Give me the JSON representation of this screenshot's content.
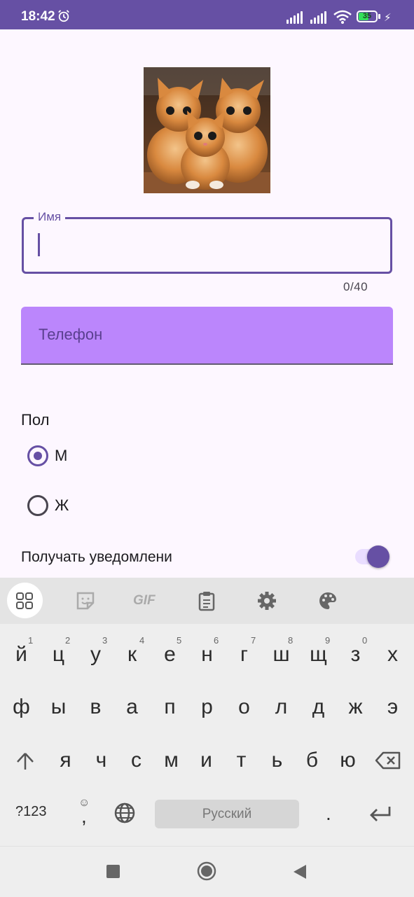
{
  "status_bar": {
    "time": "18:42",
    "battery": "35"
  },
  "form": {
    "name_label": "Имя",
    "name_counter": "0/40",
    "phone_placeholder": "Телефон",
    "gender_title": "Пол",
    "gender_options": [
      "М",
      "Ж"
    ],
    "gender_selected": "М",
    "notifications_label": "Получать уведомлени",
    "notifications_on": true
  },
  "keyboard": {
    "row1": [
      "й",
      "ц",
      "у",
      "к",
      "е",
      "н",
      "г",
      "ш",
      "щ",
      "з",
      "х"
    ],
    "row1_hints": [
      "1",
      "2",
      "3",
      "4",
      "5",
      "6",
      "7",
      "8",
      "9",
      "0"
    ],
    "row2": [
      "ф",
      "ы",
      "в",
      "а",
      "п",
      "р",
      "о",
      "л",
      "д",
      "ж",
      "э"
    ],
    "row3": [
      "я",
      "ч",
      "с",
      "м",
      "и",
      "т",
      "ь",
      "б",
      "ю"
    ],
    "symbols_key": "?123",
    "comma_key": ",",
    "space_label": "Русский",
    "period_key": ".",
    "gif_label": "GIF"
  },
  "colors": {
    "accent": "#6650a4",
    "phone_fill": "#bb86fc",
    "background": "#fdf7ff"
  }
}
